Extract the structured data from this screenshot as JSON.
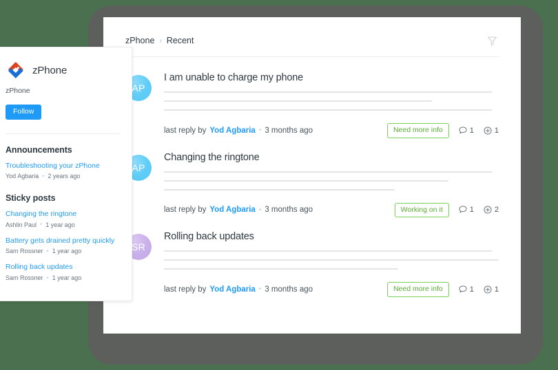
{
  "theme": {
    "background_green": "#4a7050",
    "frame_gray": "#5d5f5c",
    "panel_white": "#ffffff",
    "link_blue": "#1f9bf7",
    "status_green": "#5aab35",
    "status_green_border": "#78d054",
    "text_dark": "#2f3941",
    "text_muted": "#68737d",
    "avatar_blue": "#5fcdf6",
    "avatar_purple": "#c8b0ea"
  },
  "sidebar": {
    "logo_icon": "zphone-logo-icon",
    "brand_name": "zPhone",
    "brand_sub": "zPhone",
    "follow_label": "Follow",
    "announcements": {
      "title": "Announcements",
      "items": [
        {
          "title": "Troubleshooting your zPhone",
          "author": "Yod Agbaria",
          "time": "2 years ago"
        }
      ]
    },
    "sticky": {
      "title": "Sticky posts",
      "items": [
        {
          "title": "Changing the ringtone",
          "author": "Ashlin Paul",
          "time": "1 year ago"
        },
        {
          "title": "Battery gets drained pretty quickly",
          "author": "Sam Rossner",
          "time": "1 year ago"
        },
        {
          "title": "Rolling back updates",
          "author": "Sam Rossner",
          "time": "1 year ago"
        }
      ]
    }
  },
  "main": {
    "breadcrumb": {
      "root": "zPhone",
      "separator": "›",
      "current": "Recent"
    },
    "filter_icon": "filter-funnel-icon",
    "posts": [
      {
        "avatar_initials": "AP",
        "avatar_color": "blue",
        "title": "I am unable to charge my phone",
        "meta_prefix": "last reply by",
        "author": "Yod Agbaria",
        "separator": "•",
        "time": "3 months ago",
        "status": "Need more info",
        "comments": "1",
        "votes": "1"
      },
      {
        "avatar_initials": "AP",
        "avatar_color": "blue",
        "title": "Changing the ringtone",
        "meta_prefix": "last reply by",
        "author": "Yod Agbaria",
        "separator": "•",
        "time": "3 months ago",
        "status": "Working on it",
        "comments": "1",
        "votes": "2"
      },
      {
        "avatar_initials": "SR",
        "avatar_color": "purple",
        "title": "Rolling back updates",
        "meta_prefix": "last reply by",
        "author": "Yod Agbaria",
        "separator": "•",
        "time": "3 months ago",
        "status": "Need more info",
        "comments": "1",
        "votes": "1"
      }
    ]
  }
}
